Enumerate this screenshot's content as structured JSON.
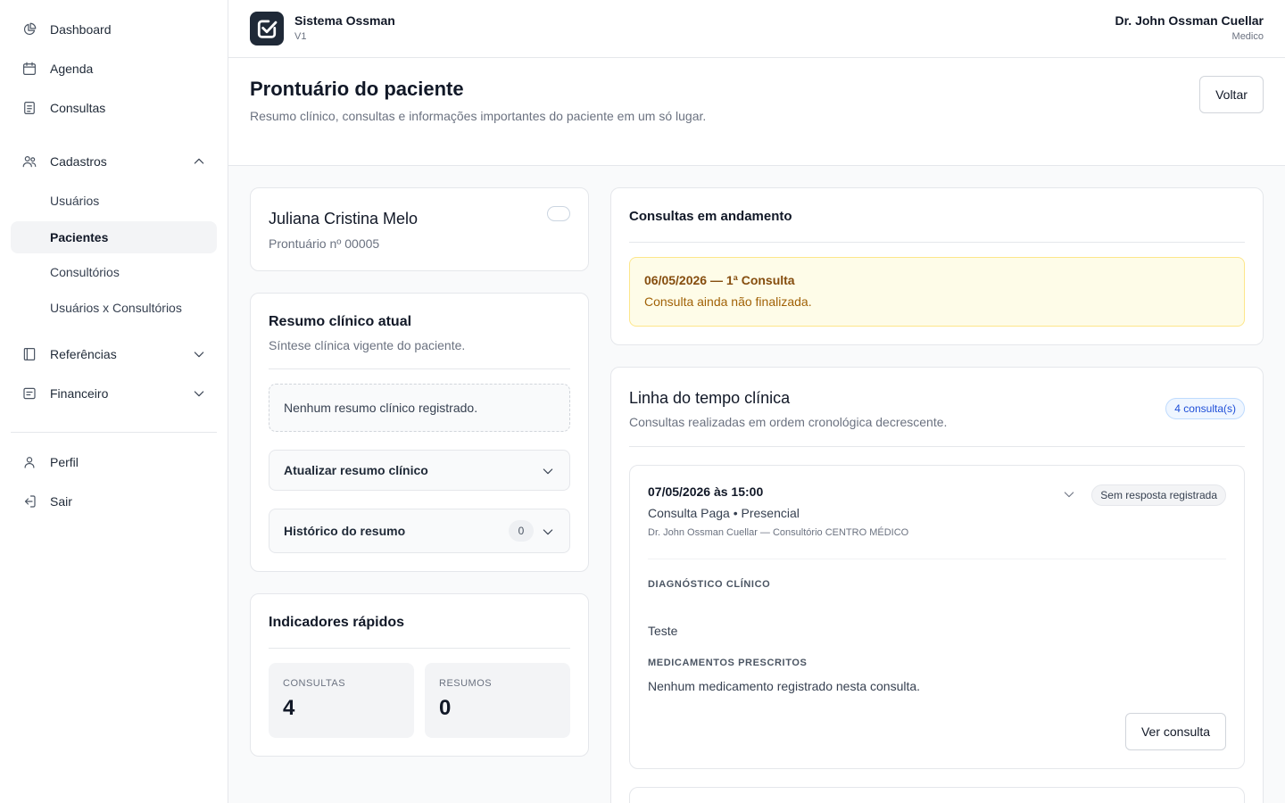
{
  "sidebar": {
    "nav": [
      {
        "label": "Dashboard",
        "icon": "chart-pie-icon"
      },
      {
        "label": "Agenda",
        "icon": "calendar-icon"
      },
      {
        "label": "Consultas",
        "icon": "document-icon"
      }
    ],
    "cadastros": {
      "label": "Cadastros",
      "icon": "users-icon",
      "items": [
        "Usuários",
        "Pacientes",
        "Consultórios",
        "Usuários x Consultórios"
      ],
      "active": "Pacientes"
    },
    "referencias": {
      "label": "Referências",
      "icon": "book-icon"
    },
    "financeiro": {
      "label": "Financeiro",
      "icon": "receipt-icon"
    },
    "perfil": {
      "label": "Perfil",
      "icon": "user-icon"
    },
    "sair": {
      "label": "Sair",
      "icon": "logout-icon"
    }
  },
  "topbar": {
    "brand_name": "Sistema Ossman",
    "brand_version": "V1",
    "user_name": "Dr. John Ossman Cuellar",
    "user_role": "Medico"
  },
  "page": {
    "title": "Prontuário do paciente",
    "subtitle": "Resumo clínico, consultas e informações importantes do paciente em um só lugar.",
    "back_label": "Voltar"
  },
  "patient": {
    "name": "Juliana Cristina Melo",
    "record": "Prontuário nº 00005"
  },
  "summary": {
    "title": "Resumo clínico atual",
    "subtitle": "Síntese clínica vigente do paciente.",
    "empty": "Nenhum resumo clínico registrado.",
    "update_label": "Atualizar resumo clínico",
    "history_label": "Histórico do resumo",
    "history_count": "0"
  },
  "indicators": {
    "title": "Indicadores rápidos",
    "consultas_label": "CONSULTAS",
    "consultas_value": "4",
    "resumos_label": "RESUMOS",
    "resumos_value": "0"
  },
  "ongoing": {
    "title": "Consultas em andamento",
    "item_title": "06/05/2026 — 1ª Consulta",
    "item_desc": "Consulta ainda não finalizada."
  },
  "timeline": {
    "title": "Linha do tempo clínica",
    "subtitle": "Consultas realizadas em ordem cronológica decrescente.",
    "count_badge": "4 consulta(s)",
    "entries": [
      {
        "date": "07/05/2026 às 15:00",
        "type": "Consulta Paga • Presencial",
        "doctor": "Dr. John Ossman Cuellar — Consultório CENTRO MÉDICO",
        "status": "Sem resposta registrada",
        "diagnosis_label": "DIAGNÓSTICO CLÍNICO",
        "diagnosis": "Teste",
        "meds_label": "MEDICAMENTOS PRESCRITOS",
        "meds": "Nenhum medicamento registrado nesta consulta.",
        "view_label": "Ver consulta"
      }
    ]
  }
}
